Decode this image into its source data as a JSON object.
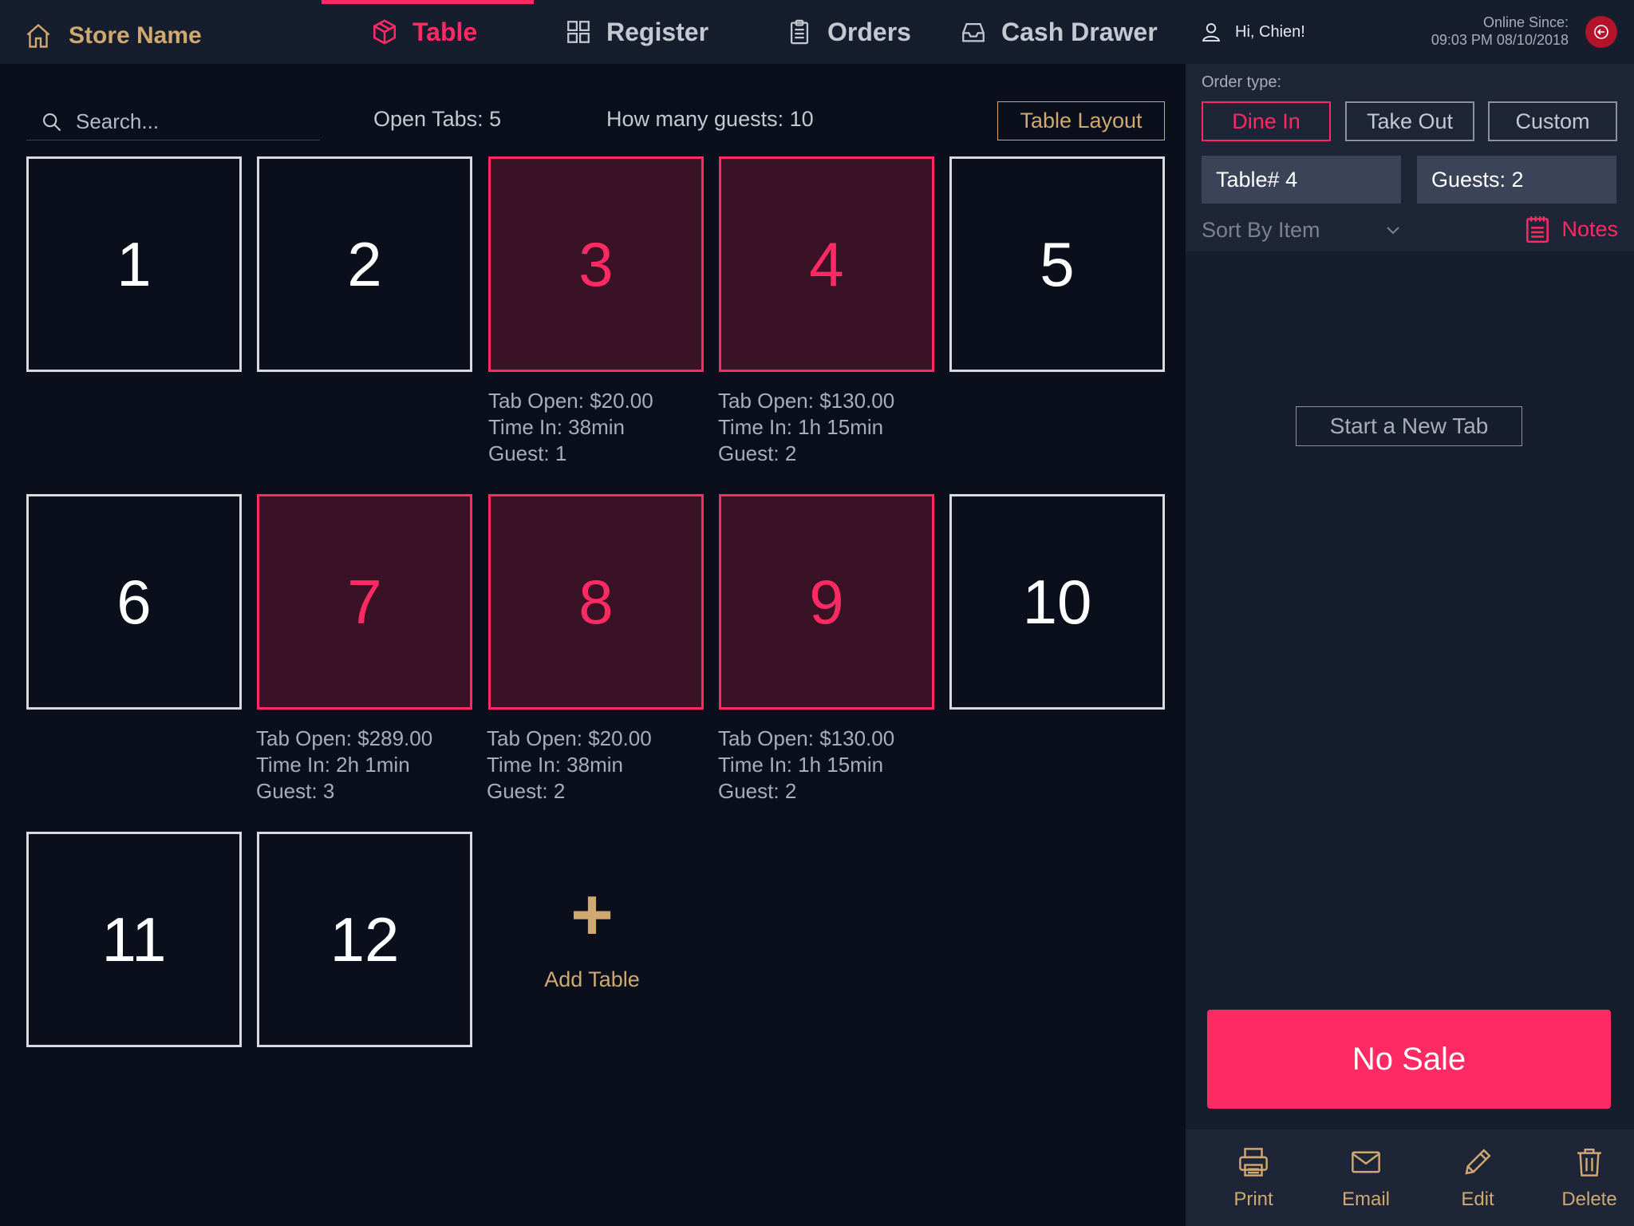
{
  "header": {
    "store_name": "Store Name",
    "tabs": [
      {
        "label": "Table",
        "active": true
      },
      {
        "label": "Register",
        "active": false
      },
      {
        "label": "Orders",
        "active": false
      },
      {
        "label": "Cash Drawer",
        "active": false
      }
    ],
    "greeting": "Hi, Chien!",
    "online_label": "Online Since:",
    "online_time": "09:03 PM 08/10/2018"
  },
  "toolbar": {
    "search_placeholder": "Search...",
    "open_tabs": "Open Tabs: 5",
    "guest_count": "How many guests: 10",
    "layout_button": "Table Layout"
  },
  "tables": [
    {
      "number": "1",
      "open": false
    },
    {
      "number": "2",
      "open": false
    },
    {
      "number": "3",
      "open": true,
      "tab": "Tab Open: $20.00",
      "time": "Time In: 38min",
      "guests": "Guest: 1"
    },
    {
      "number": "4",
      "open": true,
      "tab": "Tab Open: $130.00",
      "time": "Time In: 1h 15min",
      "guests": "Guest: 2"
    },
    {
      "number": "5",
      "open": false
    },
    {
      "number": "6",
      "open": false
    },
    {
      "number": "7",
      "open": true,
      "tab": "Tab Open: $289.00",
      "time": "Time In: 2h 1min",
      "guests": "Guest: 3"
    },
    {
      "number": "8",
      "open": true,
      "tab": "Tab Open: $20.00",
      "time": "Time In: 38min",
      "guests": "Guest: 2"
    },
    {
      "number": "9",
      "open": true,
      "tab": "Tab Open: $130.00",
      "time": "Time In: 1h 15min",
      "guests": "Guest: 2"
    },
    {
      "number": "10",
      "open": false
    },
    {
      "number": "11",
      "open": false
    },
    {
      "number": "12",
      "open": false
    }
  ],
  "add_table": {
    "symbol": "+",
    "label": "Add Table"
  },
  "panel": {
    "order_type_label": "Order type:",
    "order_types": [
      {
        "label": "Dine In",
        "active": true
      },
      {
        "label": "Take Out",
        "active": false
      },
      {
        "label": "Custom",
        "active": false
      }
    ],
    "table_field": "Table# 4",
    "guests_field": "Guests: 2",
    "sort_label": "Sort By Item",
    "notes_label": "Notes",
    "new_tab_button": "Start a New Tab",
    "no_sale_button": "No Sale",
    "footer": [
      {
        "label": "Print",
        "icon": "printer-icon"
      },
      {
        "label": "Email",
        "icon": "envelope-icon"
      },
      {
        "label": "Edit",
        "icon": "pencil-icon"
      },
      {
        "label": "Delete",
        "icon": "trash-icon"
      }
    ]
  },
  "colors": {
    "accent": "#ff2a63",
    "gold": "#cfa971",
    "background": "#0b0f1c",
    "panel": "#161d2d",
    "open_tile": "#3a1225"
  }
}
